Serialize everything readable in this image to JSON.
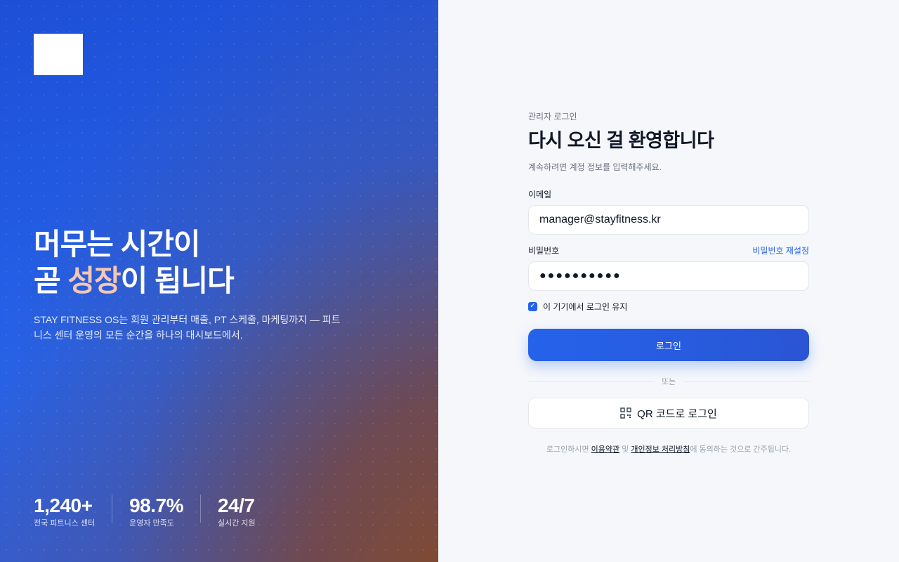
{
  "brand": {
    "logo": "logo-placeholder"
  },
  "hero": {
    "title_line1": "머무는 시간이",
    "title_line2_pre": "곧 ",
    "title_line2_accent": "성장",
    "title_line2_post": "이 됩니다",
    "description": "STAY FITNESS OS는 회원 관리부터 매출, PT 스케줄, 마케팅까지 — 피트니스 센터 운영의 모든 순간을 하나의 대시보드에서."
  },
  "stats": [
    {
      "value": "1,240+",
      "label": "전국 피트니스 센터"
    },
    {
      "value": "98.7%",
      "label": "운영자 만족도"
    },
    {
      "value": "24/7",
      "label": "실시간 지원"
    }
  ],
  "login": {
    "eyebrow": "관리자 로그인",
    "title": "다시 오신 걸 환영합니다",
    "subtitle": "계속하려면 계정 정보를 입력해주세요.",
    "email_label": "이메일",
    "email_value": "manager@stayfitness.kr",
    "password_label": "비밀번호",
    "password_value": "●●●●●●●●●●",
    "reset_link": "비밀번호 재설정",
    "remember_label": "이 기기에서 로그인 유지",
    "remember_checked": true,
    "submit_label": "로그인",
    "or_label": "또는",
    "qr_label": "QR 코드로 로그인",
    "terms_pre": "로그인하시면 ",
    "terms_link1": "이용약관",
    "terms_mid": " 및 ",
    "terms_link2": "개인정보 처리방침",
    "terms_post": "에 동의하는 것으로 간주됩니다."
  },
  "colors": {
    "accent": "#2563eb",
    "hero_accent_text": "#f6c7b3",
    "right_bg": "#f5f7fb"
  }
}
